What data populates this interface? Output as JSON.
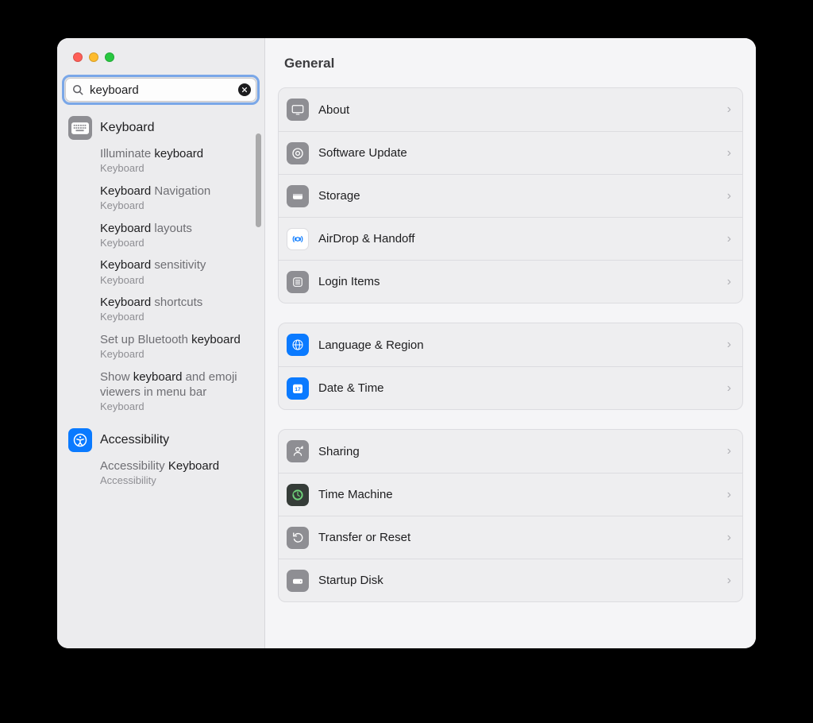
{
  "search": {
    "value": "keyboard",
    "icon": "search-icon",
    "clear_icon": "clear-icon"
  },
  "sidebar": {
    "categories": [
      {
        "icon": "keyboard-icon",
        "icon_style": "grey",
        "label": "Keyboard",
        "results": [
          {
            "title_pre": "Illuminate ",
            "title_bold": "keyboard",
            "title_post": "",
            "sub": "Keyboard"
          },
          {
            "title_pre": "",
            "title_bold": "Keyboard",
            "title_post": " Navigation",
            "sub": "Keyboard"
          },
          {
            "title_pre": "",
            "title_bold": "Keyboard",
            "title_post": " layouts",
            "sub": "Keyboard"
          },
          {
            "title_pre": "",
            "title_bold": "Keyboard",
            "title_post": " sensitivity",
            "sub": "Keyboard"
          },
          {
            "title_pre": "",
            "title_bold": "Keyboard",
            "title_post": " shortcuts",
            "sub": "Keyboard"
          },
          {
            "title_pre": "Set up Bluetooth ",
            "title_bold": "keyboard",
            "title_post": "",
            "sub": "Keyboard"
          },
          {
            "title_pre": "Show ",
            "title_bold": "keyboard",
            "title_post": " and emoji viewers in menu bar",
            "sub": "Keyboard"
          }
        ]
      },
      {
        "icon": "accessibility-icon",
        "icon_style": "blue",
        "label": "Accessibility",
        "results": [
          {
            "title_pre": "Accessibility ",
            "title_bold": "Keyboard",
            "title_post": "",
            "sub": "Accessibility"
          }
        ]
      }
    ]
  },
  "main": {
    "title": "General",
    "groups": [
      [
        {
          "icon": "about-icon",
          "icon_style": "grey",
          "label": "About"
        },
        {
          "icon": "software-update-icon",
          "icon_style": "grey",
          "label": "Software Update"
        },
        {
          "icon": "storage-icon",
          "icon_style": "grey",
          "label": "Storage"
        },
        {
          "icon": "airdrop-icon",
          "icon_style": "white",
          "label": "AirDrop & Handoff"
        },
        {
          "icon": "login-items-icon",
          "icon_style": "grey",
          "label": "Login Items"
        }
      ],
      [
        {
          "icon": "globe-icon",
          "icon_style": "blue",
          "label": "Language & Region"
        },
        {
          "icon": "date-time-icon",
          "icon_style": "blue",
          "label": "Date & Time"
        }
      ],
      [
        {
          "icon": "sharing-icon",
          "icon_style": "grey",
          "label": "Sharing"
        },
        {
          "icon": "time-machine-icon",
          "icon_style": "darkgreen",
          "label": "Time Machine"
        },
        {
          "icon": "transfer-reset-icon",
          "icon_style": "grey",
          "label": "Transfer or Reset"
        },
        {
          "icon": "startup-disk-icon",
          "icon_style": "grey",
          "label": "Startup Disk"
        }
      ]
    ]
  }
}
